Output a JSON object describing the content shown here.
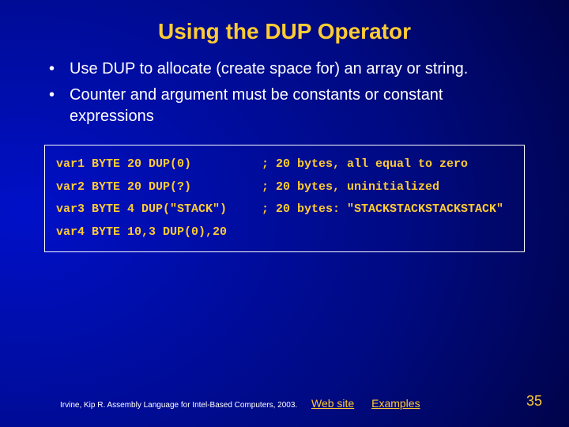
{
  "title": "Using the DUP Operator",
  "bullets": [
    "Use DUP to allocate (create space for) an array or string.",
    "Counter and argument must be constants or constant expressions"
  ],
  "code": {
    "rows": [
      {
        "decl": "var1 BYTE 20 DUP(0)",
        "comment": "; 20 bytes, all equal to zero"
      },
      {
        "decl": "var2 BYTE 20 DUP(?)",
        "comment": "; 20 bytes, uninitialized"
      },
      {
        "decl": "var3 BYTE 4 DUP(\"STACK\")",
        "comment": "; 20 bytes: \"STACKSTACKSTACKSTACK\""
      },
      {
        "decl": "var4 BYTE 10,3 DUP(0),20",
        "comment": ""
      }
    ]
  },
  "footer": {
    "credit": "Irvine, Kip R. Assembly Language for Intel-Based Computers, 2003.",
    "link1": "Web site",
    "link2": "Examples",
    "page": "35"
  }
}
